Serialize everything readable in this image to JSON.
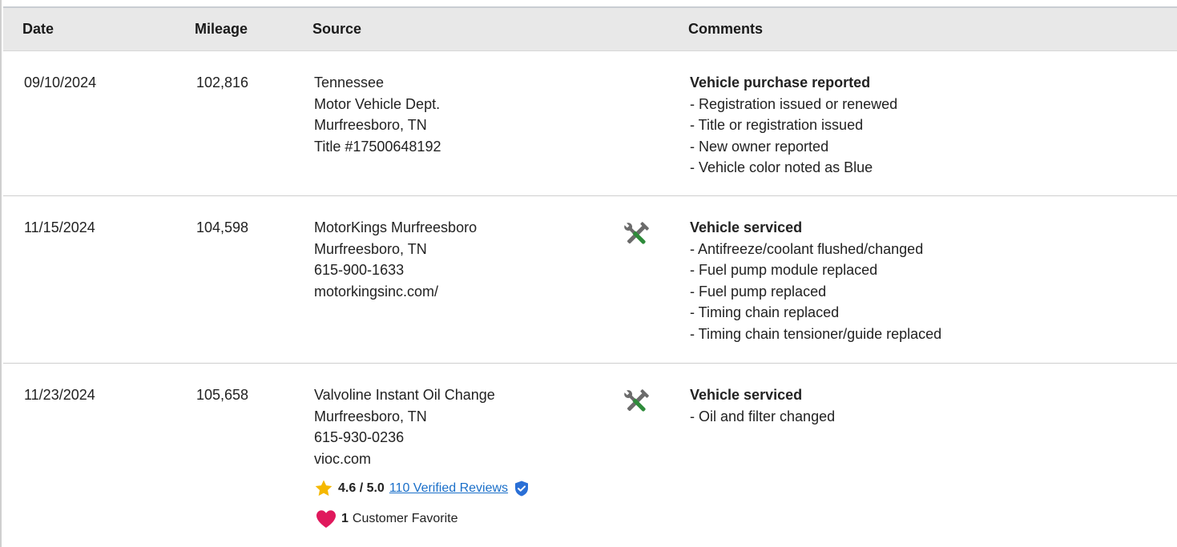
{
  "table": {
    "headers": {
      "date": "Date",
      "mileage": "Mileage",
      "source": "Source",
      "comments": "Comments"
    },
    "rows": [
      {
        "date": "09/10/2024",
        "mileage": "102,816",
        "source": [
          "Tennessee",
          "Motor Vehicle Dept.",
          "Murfreesboro, TN",
          "Title #17500648192"
        ],
        "icon": "",
        "comment_title": "Vehicle purchase reported",
        "comments": [
          "- Registration issued or renewed",
          "- Title or registration issued",
          "- New owner reported",
          "- Vehicle color noted as Blue"
        ]
      },
      {
        "date": "11/15/2024",
        "mileage": "104,598",
        "source": [
          "MotorKings Murfreesboro",
          "Murfreesboro, TN",
          "615-900-1633",
          "motorkingsinc.com/"
        ],
        "icon": "service-tools-icon",
        "comment_title": "Vehicle serviced",
        "comments": [
          "- Antifreeze/coolant flushed/changed",
          "- Fuel pump module replaced",
          "- Fuel pump replaced",
          "- Timing chain replaced",
          "- Timing chain tensioner/guide replaced"
        ]
      },
      {
        "date": "11/23/2024",
        "mileage": "105,658",
        "source": [
          "Valvoline Instant Oil Change",
          "Murfreesboro, TN",
          "615-930-0236",
          "vioc.com"
        ],
        "icon": "service-tools-icon",
        "comment_title": "Vehicle serviced",
        "comments": [
          "- Oil and filter changed"
        ],
        "rating": {
          "score": "4.6 / 5.0",
          "reviews_link": "110 Verified Reviews",
          "star_icon": "star-icon",
          "verified_icon": "verified-shield-icon"
        },
        "favorite": {
          "count": "1",
          "label": "Customer Favorite",
          "icon": "heart-icon"
        }
      }
    ]
  },
  "colors": {
    "header_bg": "#e8e8e8",
    "link": "#1a6fc9",
    "star": "#f5b800",
    "heart": "#e0185c",
    "verified": "#2a6fd6",
    "wrench_handle": "#2e8b3a",
    "tool_gray": "#6b6b6b"
  }
}
